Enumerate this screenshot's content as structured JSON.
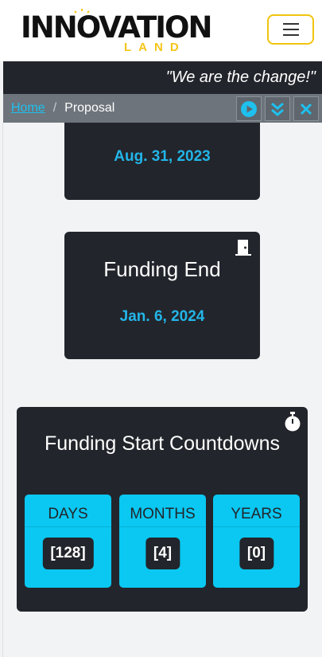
{
  "header": {
    "logo_main": "INNOVATION",
    "logo_sub": "LAND",
    "menu_icon": "hamburger-icon"
  },
  "tagline": "\"We are the change!\"",
  "breadcrumb": {
    "home": "Home",
    "separator": "/",
    "current": "Proposal",
    "actions": [
      "play-icon",
      "double-chevron-down-icon",
      "close-icon"
    ]
  },
  "cards": {
    "funding_start": {
      "date": "Aug. 31, 2023"
    },
    "funding_end": {
      "title": "Funding End",
      "date": "Jan. 6, 2024",
      "icon": "door-icon"
    }
  },
  "countdown": {
    "title": "Funding Start Countdowns",
    "icon": "stopwatch-icon",
    "boxes": [
      {
        "label": "DAYS",
        "value": "[128]"
      },
      {
        "label": "MONTHS",
        "value": "[4]"
      },
      {
        "label": "YEARS",
        "value": "[0]"
      }
    ]
  },
  "colors": {
    "dark": "#22252b",
    "accent": "#0ac8f2",
    "date_text": "#23b5e8",
    "logo_yellow": "#f5c518"
  }
}
